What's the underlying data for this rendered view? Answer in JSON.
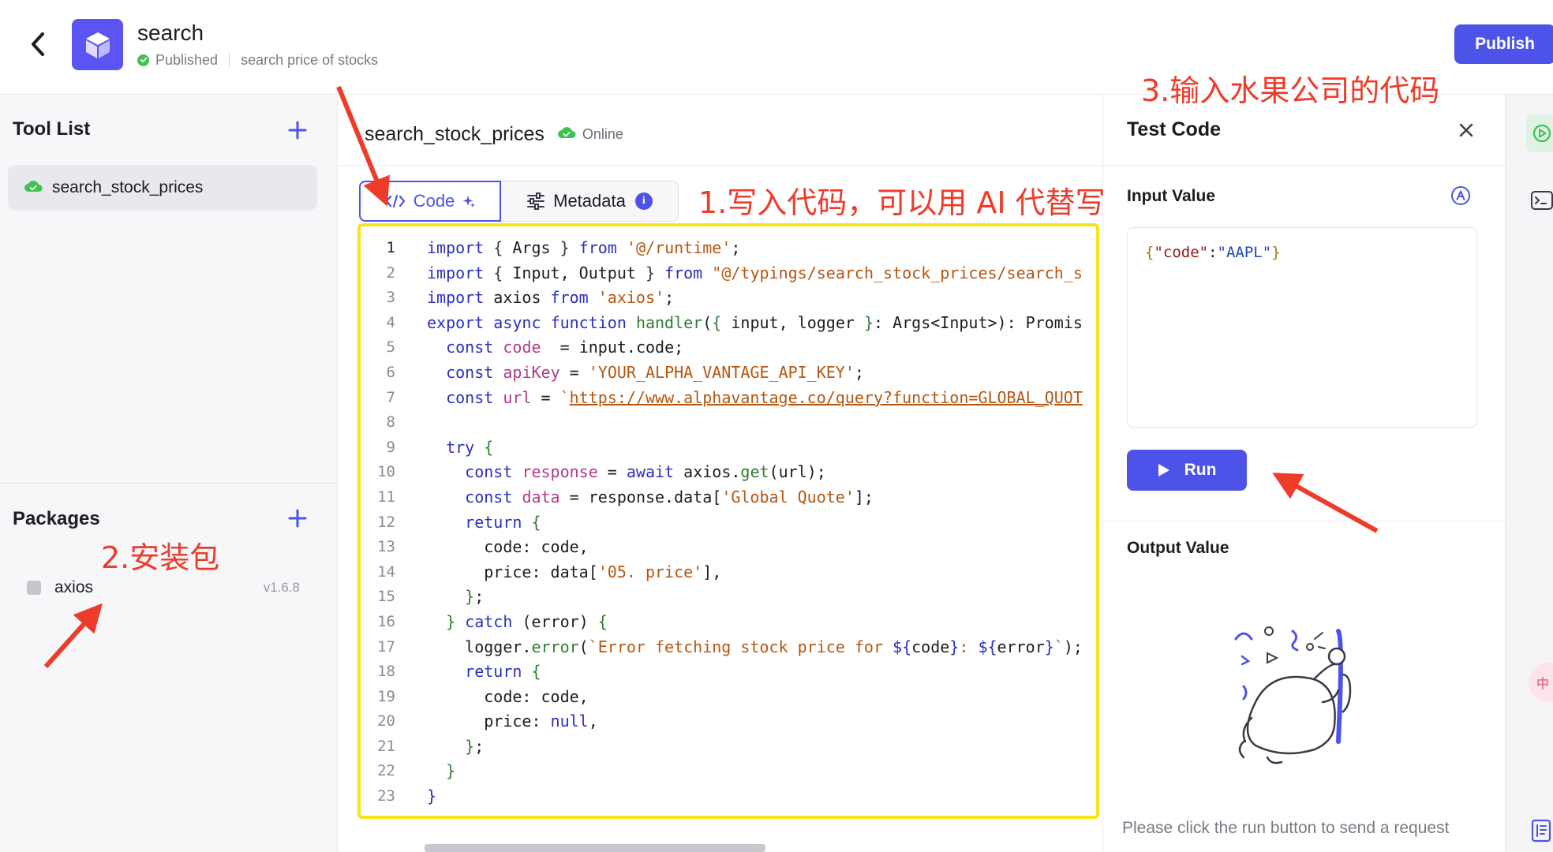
{
  "header": {
    "app_name": "search",
    "status": "Published",
    "description": "search price of stocks",
    "publish_label": "Publish"
  },
  "left_panel": {
    "tool_list_title": "Tool List",
    "tools": [
      {
        "name": "search_stock_prices"
      }
    ],
    "packages_title": "Packages",
    "packages": [
      {
        "name": "axios",
        "version": "v1.6.8"
      }
    ]
  },
  "editor": {
    "function_name": "search_stock_prices",
    "status": "Online",
    "tabs": [
      {
        "label": "Code"
      },
      {
        "label": "Metadata"
      }
    ],
    "info_badge": "i",
    "code_lines": [
      "import { Args } from '@/runtime';",
      "import { Input, Output } from \"@/typings/search_stock_prices/search_s",
      "import axios from 'axios';",
      "export async function handler({ input, logger }: Args<Input>): Promis",
      "  const code  = input.code;",
      "  const apiKey = 'YOUR_ALPHA_VANTAGE_API_KEY';",
      "  const url = `https://www.alphavantage.co/query?function=GLOBAL_QUOT",
      "",
      "  try {",
      "    const response = await axios.get(url);",
      "    const data = response.data['Global Quote'];",
      "    return {",
      "      code: code,",
      "      price: data['05. price'],",
      "    };",
      "  } catch (error) {",
      "    logger.error(`Error fetching stock price for ${code}: ${error}`);",
      "    return {",
      "      code: code,",
      "      price: null,",
      "    };",
      "  }",
      "}"
    ]
  },
  "test_panel": {
    "title": "Test Code",
    "input_label": "Input Value",
    "input_value": "{\"code\":\"AAPL\"}",
    "run_label": "Run",
    "output_label": "Output Value",
    "hint": "Please click the run button to send a request"
  },
  "side_strip": {
    "lang_label": "中"
  },
  "annotations": {
    "step1": "1.写入代码，可以用 AI 代替写",
    "step2": "2.安装包",
    "step3": "3.输入水果公司的代码"
  },
  "colors": {
    "primary": "#4d53e8",
    "success": "#3ec254",
    "annotation": "#ee3b2a",
    "highlight_box": "#f6e51a"
  },
  "icons": {
    "back": "chevron-left-icon",
    "app": "cube-icon",
    "add": "plus-icon",
    "cloud": "cloud-check-icon",
    "code": "code-icon",
    "sparkle": "sparkle-icon",
    "metadata": "sliders-icon",
    "close": "close-icon",
    "ai": "ai-badge-icon",
    "play": "play-icon",
    "debug": "debug-icon",
    "terminal": "terminal-icon",
    "doc": "doc-icon"
  }
}
